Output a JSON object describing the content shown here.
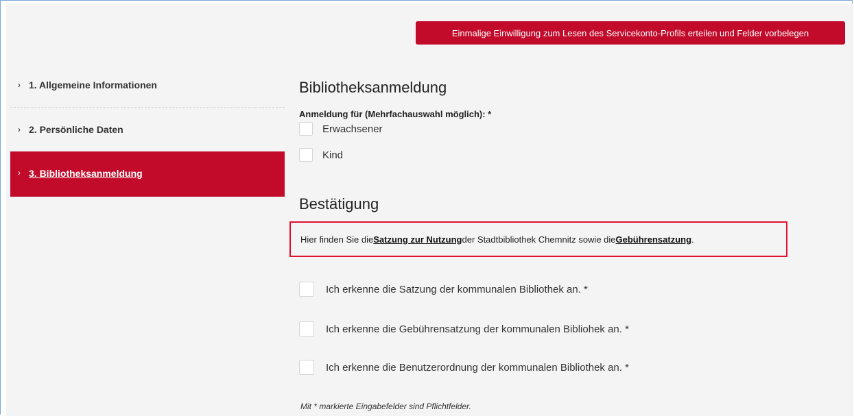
{
  "header": {
    "consent_button_label": "Einmalige Einwilligung zum Lesen des Servicekonto-Profils erteilen und Felder vorbelegen"
  },
  "sidebar": {
    "items": [
      {
        "label": "1. Allgemeine Informationen",
        "active": false
      },
      {
        "label": "2. Persönliche Daten",
        "active": false
      },
      {
        "label": "3. Bibliotheksanmeldung",
        "active": true
      }
    ]
  },
  "form": {
    "registration_title": "Bibliotheksanmeldung",
    "registration_field_label": "Anmeldung für (Mehrfachauswahl möglich): *",
    "registration_options": [
      {
        "label": "Erwachsener",
        "checked": false
      },
      {
        "label": "Kind",
        "checked": false
      }
    ],
    "confirmation_title": "Bestätigung",
    "notice": {
      "text_1": "Hier finden Sie die ",
      "link_1": "Satzung zur Nutzung",
      "text_2": " der Stadtbibliothek Chemnitz sowie die ",
      "link_2": "Gebührensatzung",
      "text_3": "."
    },
    "agreements": [
      {
        "label": "Ich erkenne die Satzung der kommunalen Bibliothek an. *",
        "checked": false
      },
      {
        "label": "Ich erkenne die Gebührensatzung der kommunalen Bibliohek an. *",
        "checked": false
      },
      {
        "label": "Ich erkenne die Benutzerordnung der kommunalen Bibliothek an. *",
        "checked": false
      }
    ],
    "required_note": "Mit * markierte Eingabefelder sind Pflichtfelder."
  },
  "colors": {
    "accent": "#c20a2a",
    "highlight_border": "#e0102e",
    "background": "#f4f4f4"
  }
}
